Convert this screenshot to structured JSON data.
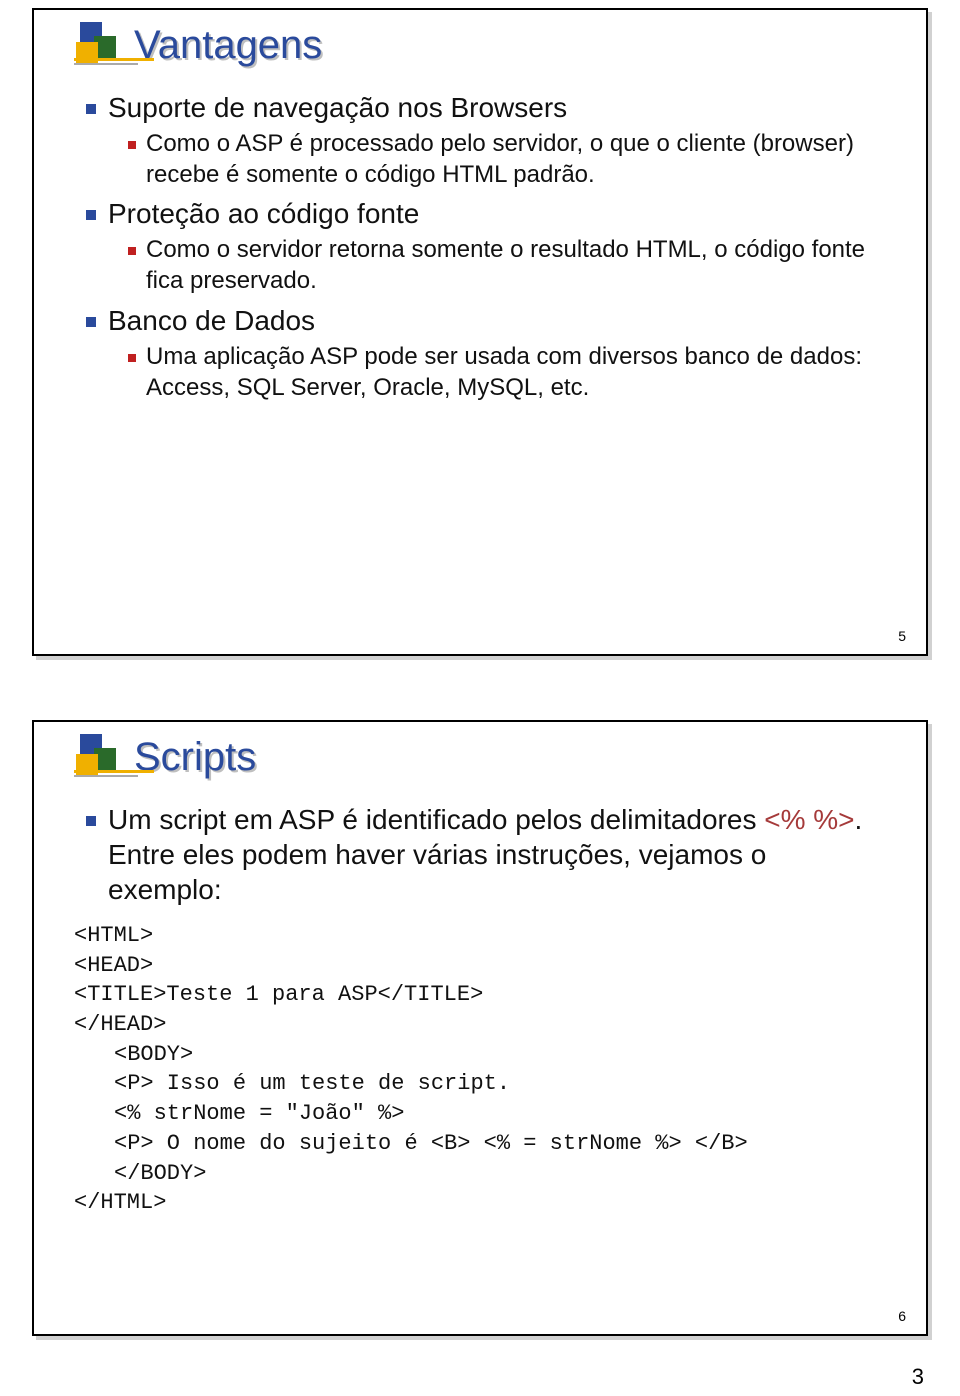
{
  "slide1": {
    "title": "Vantagens",
    "items": [
      {
        "label": "Suporte de navegação nos Browsers",
        "sub": "Como o ASP é processado pelo servidor, o que o cliente (browser) recebe é somente o código HTML padrão."
      },
      {
        "label": "Proteção ao código fonte",
        "sub": "Como o servidor retorna somente o resultado HTML, o código fonte fica preservado."
      },
      {
        "label": "Banco de Dados",
        "sub": "Uma aplicação ASP pode ser usada com diversos banco de dados: Access, SQL Server, Oracle, MySQL, etc."
      }
    ],
    "num": "5"
  },
  "slide2": {
    "title": "Scripts",
    "intro_a": "Um script em ASP é identificado pelos delimitadores ",
    "intro_red": "<% %>",
    "intro_b": ". Entre eles podem haver várias instruções, vejamos o exemplo:",
    "code": {
      "l1": "<HTML>",
      "l2": "<HEAD>",
      "l3": "<TITLE>Teste 1 para ASP</TITLE>",
      "l4": "</HEAD>",
      "l5": "<BODY>",
      "l6": "<P> Isso é um teste de script.",
      "l7": "<% strNome = \"João\" %>",
      "l8": "<P> O nome do sujeito é <B> <% = strNome %> </B>",
      "l9": "</BODY>",
      "l10": "</HTML>"
    },
    "num": "6"
  },
  "page": "3"
}
